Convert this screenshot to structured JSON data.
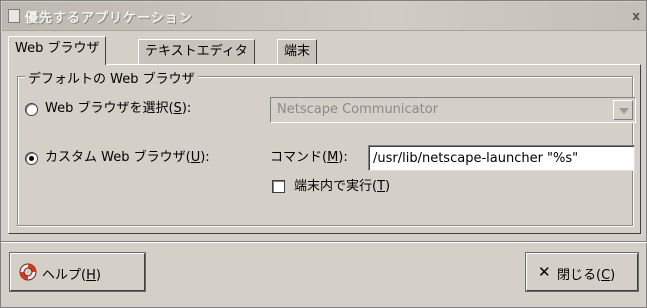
{
  "window": {
    "title": "優先するアプリケーション",
    "close_glyph": "x"
  },
  "tabs": [
    {
      "label": "Web ブラウザ",
      "active": true
    },
    {
      "label": "テキストエディタ",
      "active": false
    },
    {
      "label": "端末",
      "active": false
    }
  ],
  "frame": {
    "label": "デフォルトの Web ブラウザ"
  },
  "select_radio": {
    "label_prefix": "Web ブラウザを選択(",
    "mnemonic": "S",
    "label_suffix": "):",
    "selected": false
  },
  "browser_combo": {
    "value": "Netscape Communicator",
    "enabled": false
  },
  "custom_radio": {
    "label_prefix": "カスタム Web ブラウザ(",
    "mnemonic": "U",
    "label_suffix": "):",
    "selected": true
  },
  "command": {
    "label_prefix": "コマンド(",
    "mnemonic": "M",
    "label_suffix": "):",
    "value": "/usr/lib/netscape-launcher \"%s\""
  },
  "terminal_checkbox": {
    "label_prefix": "端末内で実行(",
    "mnemonic": "T",
    "label_suffix": ")",
    "checked": false
  },
  "buttons": {
    "help": {
      "label_prefix": "ヘルプ(",
      "mnemonic": "H",
      "label_suffix": ")"
    },
    "close": {
      "label_prefix": "閉じる(",
      "mnemonic": "C",
      "label_suffix": ")"
    }
  },
  "colors": {
    "dialog_bg": "#d4d0c8",
    "disabled_text": "#8a8a8a",
    "help_icon_red": "#d83a20"
  }
}
